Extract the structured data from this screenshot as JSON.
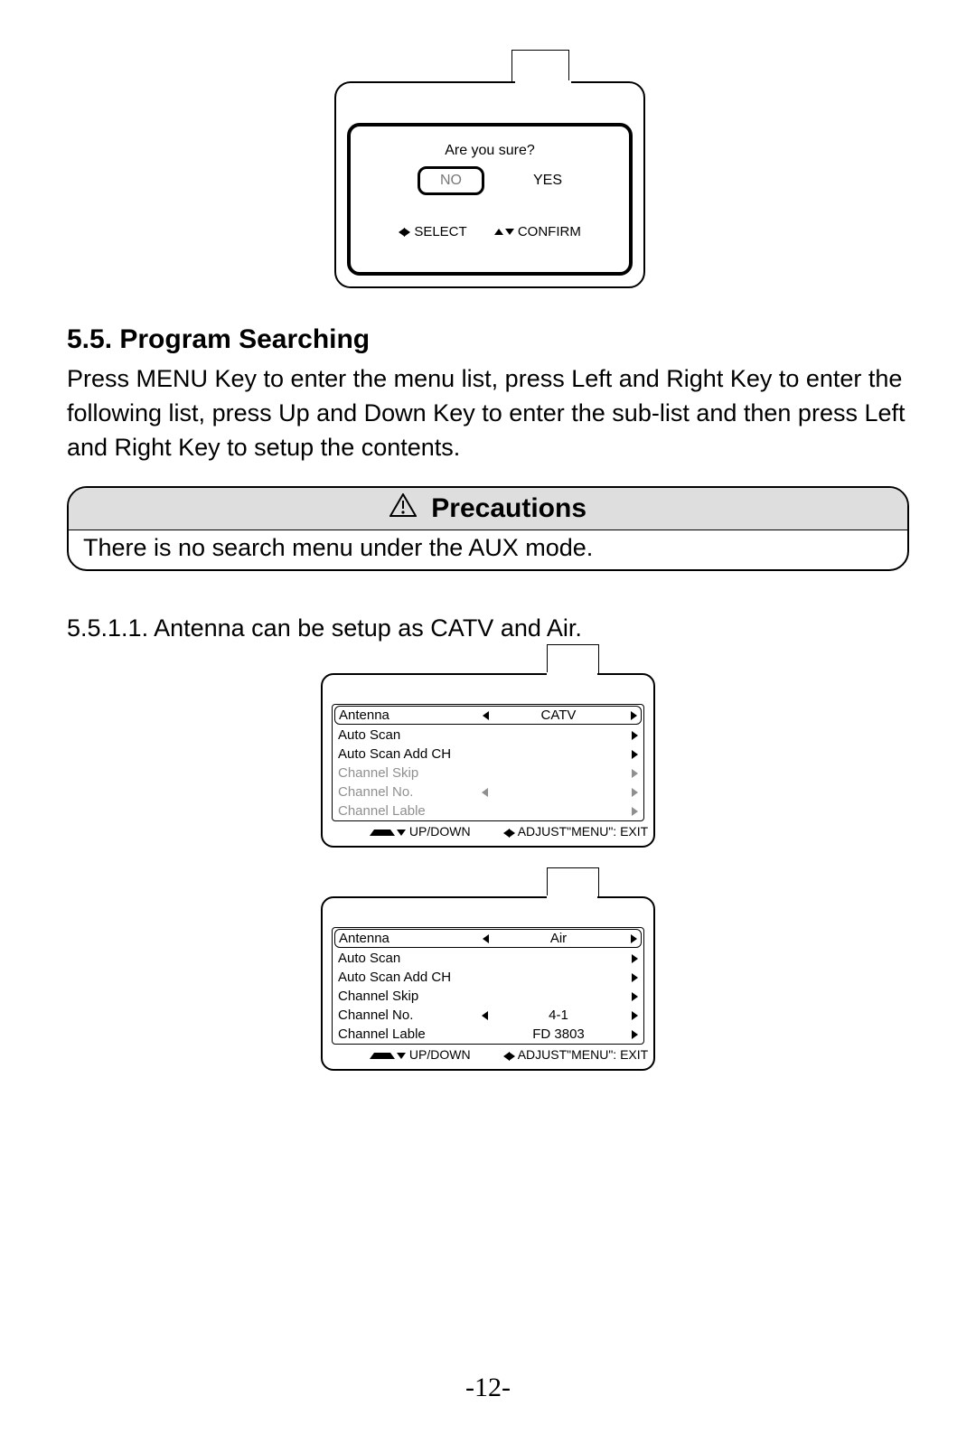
{
  "dialog": {
    "question": "Are you sure?",
    "no": "NO",
    "yes": "YES",
    "select_hint": "SELECT",
    "confirm_hint": "CONFIRM"
  },
  "section": {
    "number_title": "5.5. Program Searching",
    "body": "Press MENU Key to enter the menu list, press Left and Right Key to enter the following list, press Up and Down Key to enter the sub-list and then press Left and Right Key to setup the contents."
  },
  "precautions": {
    "title": "Precautions",
    "body": "There is no search menu under the AUX mode."
  },
  "subsection": {
    "title": "5.5.1.1. Antenna can be setup as CATV and Air."
  },
  "menu1": {
    "items": [
      {
        "label": "Antenna",
        "value": "CATV",
        "left": true,
        "right": true,
        "selected": true,
        "disabled": false
      },
      {
        "label": "Auto Scan",
        "value": "",
        "left": false,
        "right": true,
        "selected": false,
        "disabled": false
      },
      {
        "label": "Auto Scan Add CH",
        "value": "",
        "left": false,
        "right": true,
        "selected": false,
        "disabled": false
      },
      {
        "label": "Channel Skip",
        "value": "",
        "left": false,
        "right": true,
        "selected": false,
        "disabled": true
      },
      {
        "label": "Channel No.",
        "value": "",
        "left": true,
        "right": true,
        "selected": false,
        "disabled": true
      },
      {
        "label": "Channel Lable",
        "value": "",
        "left": false,
        "right": true,
        "selected": false,
        "disabled": true
      }
    ],
    "footer": {
      "updown": "UP/DOWN",
      "adjust": "ADJUST",
      "exit": "\"MENU\": EXIT"
    }
  },
  "menu2": {
    "items": [
      {
        "label": "Antenna",
        "value": "Air",
        "left": true,
        "right": true,
        "selected": true,
        "disabled": false
      },
      {
        "label": "Auto Scan",
        "value": "",
        "left": false,
        "right": true,
        "selected": false,
        "disabled": false
      },
      {
        "label": "Auto Scan Add CH",
        "value": "",
        "left": false,
        "right": true,
        "selected": false,
        "disabled": false
      },
      {
        "label": "Channel Skip",
        "value": "",
        "left": false,
        "right": true,
        "selected": false,
        "disabled": false
      },
      {
        "label": "Channel No.",
        "value": "4-1",
        "left": true,
        "right": true,
        "selected": false,
        "disabled": false
      },
      {
        "label": "Channel Lable",
        "value": "FD 3803",
        "left": false,
        "right": true,
        "selected": false,
        "disabled": false
      }
    ],
    "footer": {
      "updown": "UP/DOWN",
      "adjust": "ADJUST",
      "exit": "\"MENU\": EXIT"
    }
  },
  "page_number": "-12-"
}
